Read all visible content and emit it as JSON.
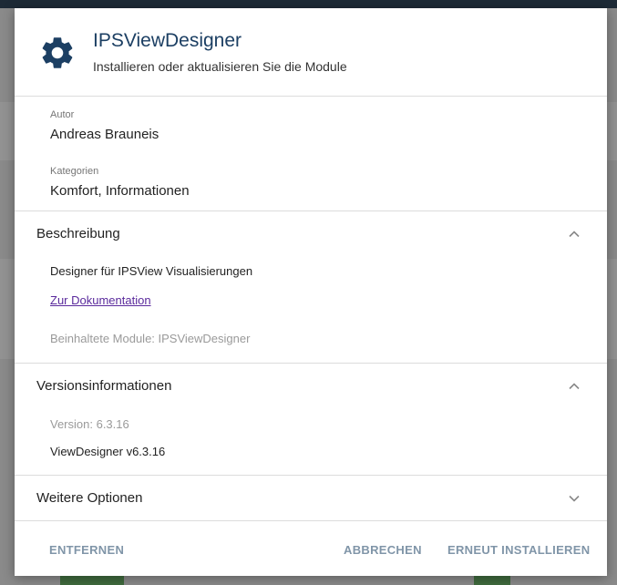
{
  "dialog": {
    "title": "IPSViewDesigner",
    "subtitle": "Installieren oder aktualisieren Sie die Module",
    "icon": "gear-icon"
  },
  "info": {
    "author_label": "Autor",
    "author_value": "Andreas Brauneis",
    "category_label": "Kategorien",
    "category_value": "Komfort, Informationen"
  },
  "description": {
    "heading": "Beschreibung",
    "text": "Designer für IPSView Visualisierungen",
    "link": "Zur Dokumentation",
    "modules": "Beinhaltete Module: IPSViewDesigner",
    "expanded": true
  },
  "version": {
    "heading": "Versionsinformationen",
    "version": "Version: 6.3.16",
    "detail": "ViewDesigner v6.3.16",
    "expanded": true
  },
  "options": {
    "heading": "Weitere Optionen",
    "expanded": false
  },
  "footer": {
    "remove": "ENTFERNEN",
    "cancel": "ABBRECHEN",
    "reinstall": "ERNEUT INSTALLIEREN"
  },
  "colors": {
    "title": "#1c3f63",
    "button": "#8095a8",
    "link": "#5a2a9c"
  }
}
